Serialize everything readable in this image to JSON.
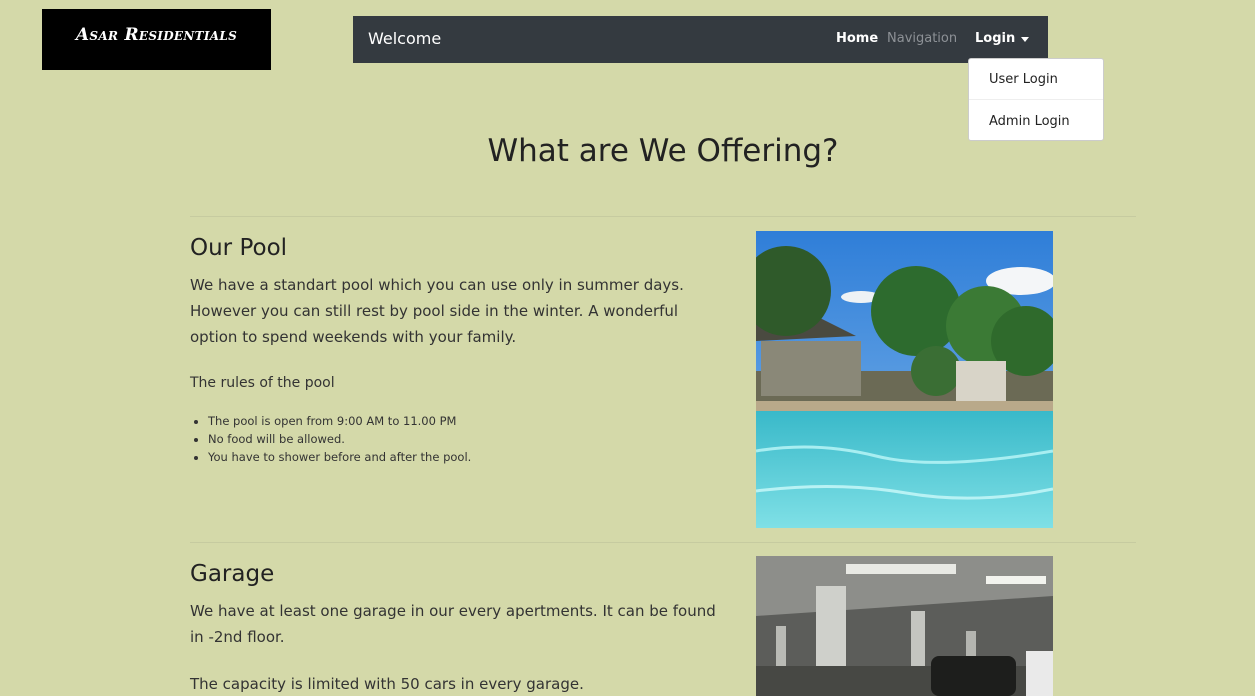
{
  "header": {
    "logo_text": "Asar Residentials"
  },
  "navbar": {
    "brand": "Welcome",
    "links": [
      "Home",
      "Navigation",
      "Login"
    ]
  },
  "dropdown": {
    "items": [
      "User Login",
      "Admin Login"
    ]
  },
  "main": {
    "title": "What are We Offering?",
    "sections": [
      {
        "title": "Our Pool",
        "description": "We have a standart pool which you can use only in summer days. However you can still rest by pool side in the winter. A wonderful option to spend weekends with your family.",
        "rules_title": "The rules of the pool",
        "rules": [
          "The pool is open from 9:00 AM to 11.00 PM",
          "No food will be allowed.",
          "You have to shower before and after the pool."
        ]
      },
      {
        "title": "Garage",
        "description": "We have at least one garage in our every apertments. It can be found in -2nd floor.",
        "capacity": "The capacity is limited with 50 cars in every garage."
      }
    ]
  },
  "colors": {
    "background": "#d4d9a9",
    "navbar": "#343a40",
    "logo_bg": "#000000"
  }
}
